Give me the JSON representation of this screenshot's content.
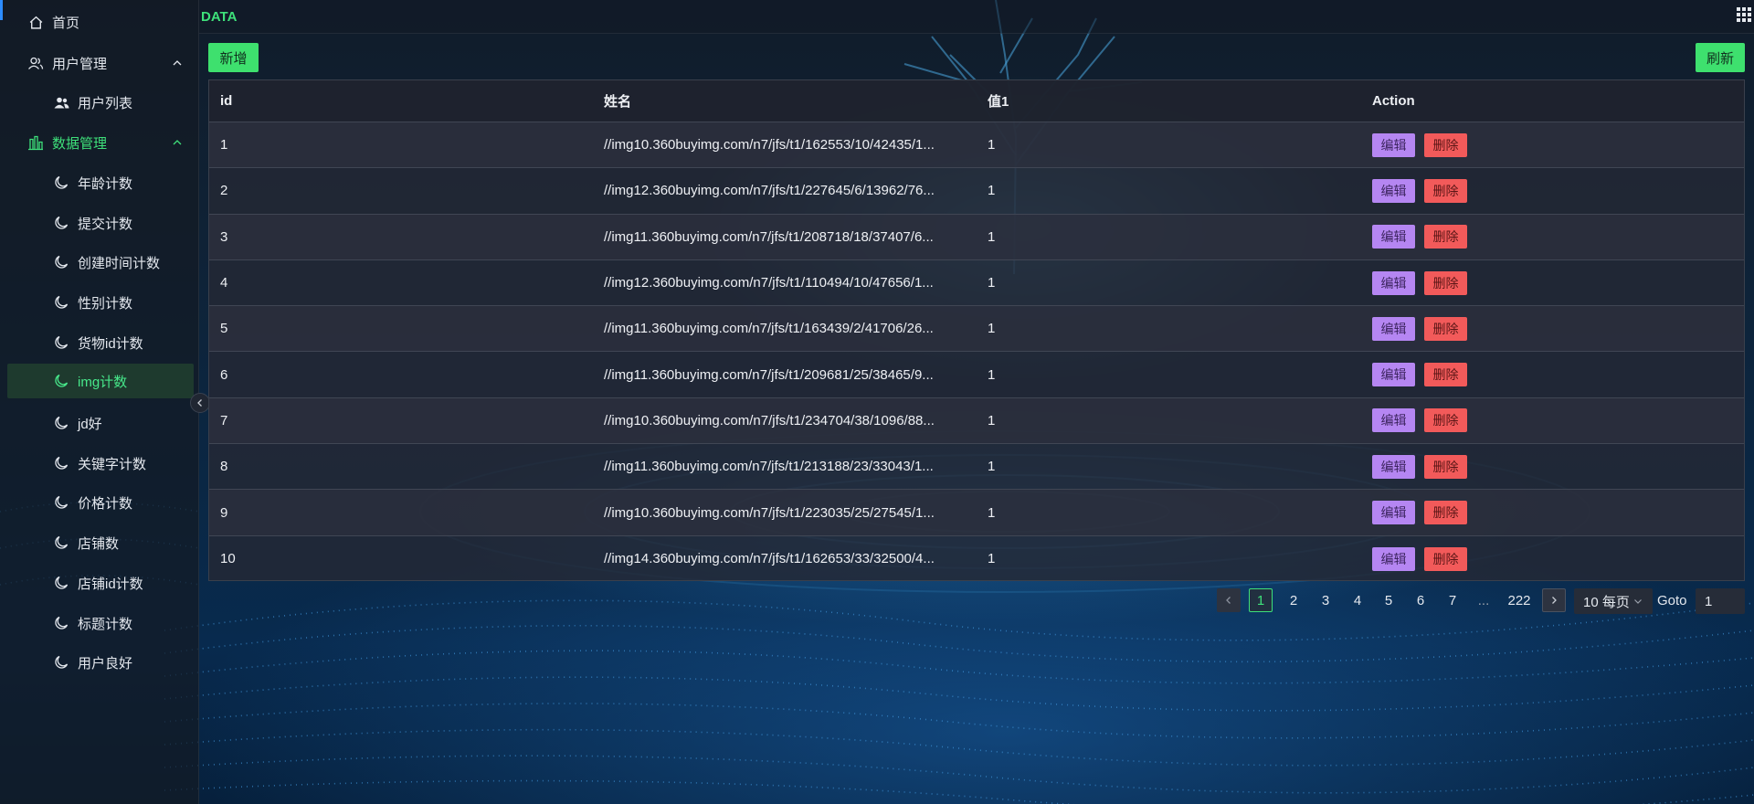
{
  "sidebar": {
    "items": [
      {
        "label": "首页",
        "icon": "home-icon"
      },
      {
        "label": "用户管理",
        "icon": "users-icon",
        "expanded": true
      },
      {
        "label": "用户列表",
        "icon": "user-group-icon"
      },
      {
        "label": "数据管理",
        "icon": "bar-chart-icon",
        "expanded": true
      },
      {
        "label": "年龄计数",
        "icon": "moon-icon"
      },
      {
        "label": "提交计数",
        "icon": "moon-icon"
      },
      {
        "label": "创建时间计数",
        "icon": "moon-icon"
      },
      {
        "label": "性别计数",
        "icon": "moon-icon"
      },
      {
        "label": "货物id计数",
        "icon": "moon-icon"
      },
      {
        "label": "img计数",
        "icon": "moon-icon",
        "selected": true
      },
      {
        "label": "jd好",
        "icon": "moon-icon"
      },
      {
        "label": "关键字计数",
        "icon": "moon-icon"
      },
      {
        "label": "价格计数",
        "icon": "moon-icon"
      },
      {
        "label": "店铺数",
        "icon": "moon-icon"
      },
      {
        "label": "店铺id计数",
        "icon": "moon-icon"
      },
      {
        "label": "标题计数",
        "icon": "moon-icon"
      },
      {
        "label": "用户良好",
        "icon": "moon-icon"
      }
    ]
  },
  "header": {
    "title": "DATA",
    "apps_icon": "grid-icon"
  },
  "toolbar": {
    "add_label": "新增",
    "refresh_label": "刷新"
  },
  "table": {
    "columns": [
      "id",
      "姓名",
      "值1",
      "Action"
    ],
    "rows": [
      {
        "id": "1",
        "name": "//img10.360buyimg.com/n7/jfs/t1/162553/10/42435/1...",
        "val": "1"
      },
      {
        "id": "2",
        "name": "//img12.360buyimg.com/n7/jfs/t1/227645/6/13962/76...",
        "val": "1"
      },
      {
        "id": "3",
        "name": "//img11.360buyimg.com/n7/jfs/t1/208718/18/37407/6...",
        "val": "1"
      },
      {
        "id": "4",
        "name": "//img12.360buyimg.com/n7/jfs/t1/110494/10/47656/1...",
        "val": "1"
      },
      {
        "id": "5",
        "name": "//img11.360buyimg.com/n7/jfs/t1/163439/2/41706/26...",
        "val": "1"
      },
      {
        "id": "6",
        "name": "//img11.360buyimg.com/n7/jfs/t1/209681/25/38465/9...",
        "val": "1"
      },
      {
        "id": "7",
        "name": "//img10.360buyimg.com/n7/jfs/t1/234704/38/1096/88...",
        "val": "1"
      },
      {
        "id": "8",
        "name": "//img11.360buyimg.com/n7/jfs/t1/213188/23/33043/1...",
        "val": "1"
      },
      {
        "id": "9",
        "name": "//img10.360buyimg.com/n7/jfs/t1/223035/25/27545/1...",
        "val": "1"
      },
      {
        "id": "10",
        "name": "//img14.360buyimg.com/n7/jfs/t1/162653/33/32500/4...",
        "val": "1"
      }
    ],
    "edit_label": "编辑",
    "delete_label": "删除"
  },
  "pagination": {
    "pages": [
      "1",
      "2",
      "3",
      "4",
      "5",
      "6",
      "7",
      "...",
      "222"
    ],
    "current": "1",
    "page_size": "10 每页",
    "goto_label": "Goto",
    "goto_value": "1"
  },
  "colors": {
    "accent_green": "#3ee07a",
    "edit_purple": "#b586f2",
    "delete_red": "#f25a5a"
  }
}
